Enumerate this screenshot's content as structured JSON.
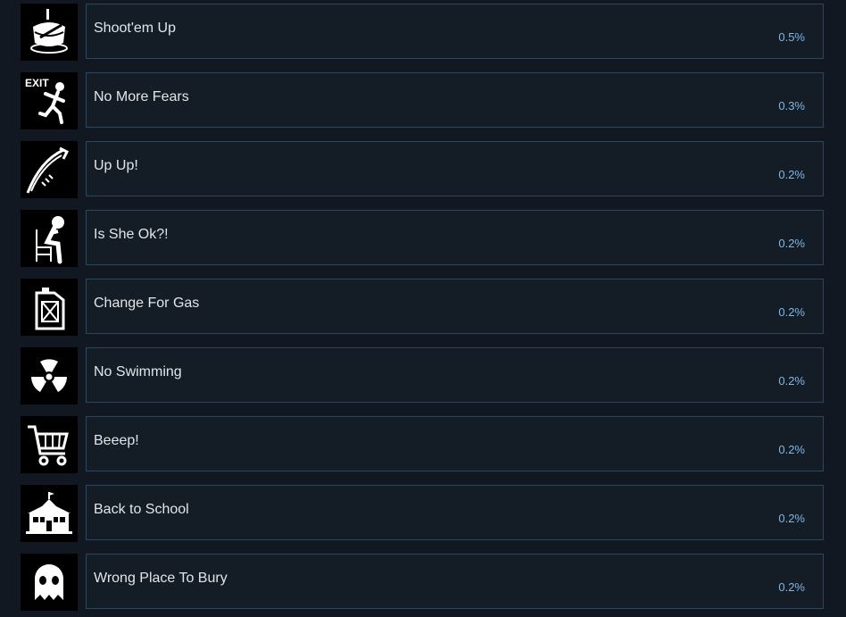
{
  "achievements": [
    {
      "title": "Shoot'em Up",
      "percent": "0.5%",
      "icon": "cake-icon"
    },
    {
      "title": "No More Fears",
      "percent": "0.3%",
      "icon": "exit-runner-icon",
      "icon_text": "EXIT"
    },
    {
      "title": "Up Up!",
      "percent": "0.2%",
      "icon": "jump-arc-icon"
    },
    {
      "title": "Is She Ok?!",
      "percent": "0.2%",
      "icon": "sitting-person-icon"
    },
    {
      "title": "Change For Gas",
      "percent": "0.2%",
      "icon": "gas-can-icon"
    },
    {
      "title": "No Swimming",
      "percent": "0.2%",
      "icon": "radiation-icon"
    },
    {
      "title": "Beeep!",
      "percent": "0.2%",
      "icon": "shopping-cart-icon"
    },
    {
      "title": "Back to School",
      "percent": "0.2%",
      "icon": "school-building-icon"
    },
    {
      "title": "Wrong Place To Bury",
      "percent": "0.2%",
      "icon": "ghost-icon"
    }
  ],
  "colors": {
    "background": "#111821",
    "card_border": "#2a475e",
    "title_text": "#e2e6ea",
    "percent_text": "#7fb7e6"
  }
}
